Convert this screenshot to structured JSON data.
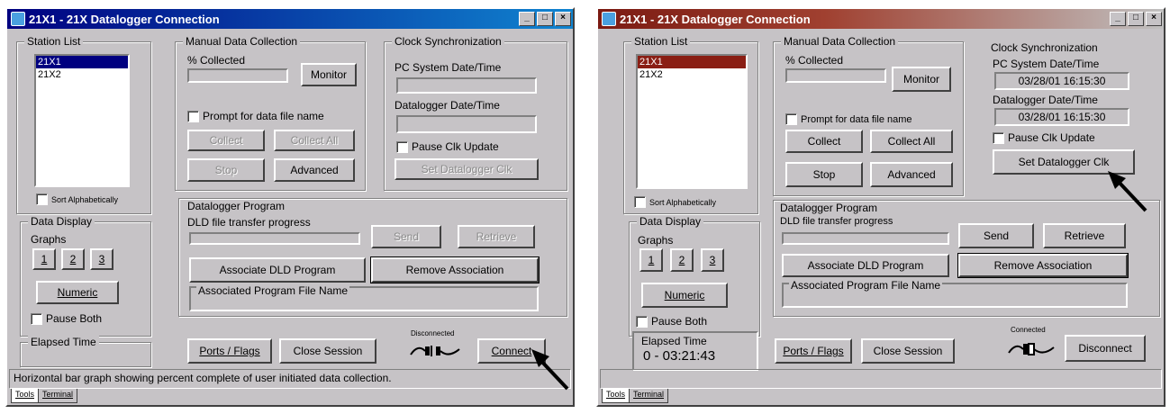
{
  "left_window": {
    "title": "21X1 - 21X Datalogger Connection",
    "stations_legend": "Station List",
    "stations": [
      "21X1",
      "21X2"
    ],
    "sort_alpha": "Sort Alphabetically",
    "data_display_legend": "Data Display",
    "graphs_label": "Graphs",
    "graph_buttons": [
      "1",
      "2",
      "3"
    ],
    "numeric": "Numeric",
    "pause_both": "Pause Both",
    "elapsed_legend": "Elapsed Time",
    "elapsed_value": "",
    "manual_legend": "Manual Data Collection",
    "pct_collected": "% Collected",
    "monitor": "Monitor",
    "prompt_file": "Prompt for data file name",
    "collect": "Collect",
    "collect_all": "Collect All",
    "stop": "Stop",
    "advanced": "Advanced",
    "clock_legend": "Clock Synchronization",
    "pc_time_label": "PC System Date/Time",
    "pc_time_value": "",
    "dl_time_label": "Datalogger Date/Time",
    "dl_time_value": "",
    "pause_clk": "Pause Clk Update",
    "set_dl_clk": "Set Datalogger Clk",
    "program_legend": "Datalogger Program",
    "dld_progress": "DLD file transfer progress",
    "send": "Send",
    "retrieve": "Retrieve",
    "associate": "Associate DLD Program",
    "remove_assoc": "Remove Association",
    "assoc_file_label": "Associated Program File Name",
    "ports_flags": "Ports / Flags",
    "close_session": "Close Session",
    "conn_status": "Disconnected",
    "connect_btn": "Connect",
    "status_text": "Horizontal bar graph showing percent complete of user initiated data collection.",
    "tabs": [
      "Tools",
      "Terminal"
    ]
  },
  "right_window": {
    "title": "21X1 - 21X Datalogger Connection",
    "stations_legend": "Station List",
    "stations": [
      "21X1",
      "21X2"
    ],
    "sort_alpha": "Sort Alphabetically",
    "data_display_legend": "Data Display",
    "graphs_label": "Graphs",
    "graph_buttons": [
      "1",
      "2",
      "3"
    ],
    "numeric": "Numeric",
    "pause_both": "Pause Both",
    "elapsed_legend": "Elapsed Time",
    "elapsed_value": "0 - 03:21:43",
    "manual_legend": "Manual Data Collection",
    "pct_collected": "% Collected",
    "monitor": "Monitor",
    "prompt_file": "Prompt for data file name",
    "collect": "Collect",
    "collect_all": "Collect All",
    "stop": "Stop",
    "advanced": "Advanced",
    "clock_legend": "Clock Synchronization",
    "pc_time_label": "PC System Date/Time",
    "pc_time_value": "03/28/01 16:15:30",
    "dl_time_label": "Datalogger Date/Time",
    "dl_time_value": "03/28/01 16:15:30",
    "pause_clk": "Pause Clk Update",
    "set_dl_clk": "Set Datalogger Clk",
    "program_legend": "Datalogger Program",
    "dld_progress": "DLD file transfer progress",
    "send": "Send",
    "retrieve": "Retrieve",
    "associate": "Associate DLD Program",
    "remove_assoc": "Remove Association",
    "assoc_file_label": "Associated Program File Name",
    "ports_flags": "Ports / Flags",
    "close_session": "Close Session",
    "conn_status": "Connected",
    "connect_btn": "Disconnect",
    "status_text": "",
    "tabs": [
      "Tools",
      "Terminal"
    ]
  },
  "icons": {
    "title_icon": "app-icon",
    "min_max_close": [
      "minimize-icon",
      "maximize-icon",
      "close-icon"
    ],
    "connection": "plug-connection-icon",
    "pointer": "black-arrow-pointer"
  },
  "colors": {
    "left_titlebar": "#000080",
    "right_titlebar": "#7b1a12",
    "window_face": "#c6c3c6",
    "left_selection": "#000080",
    "right_selection": "#8a1e14"
  }
}
